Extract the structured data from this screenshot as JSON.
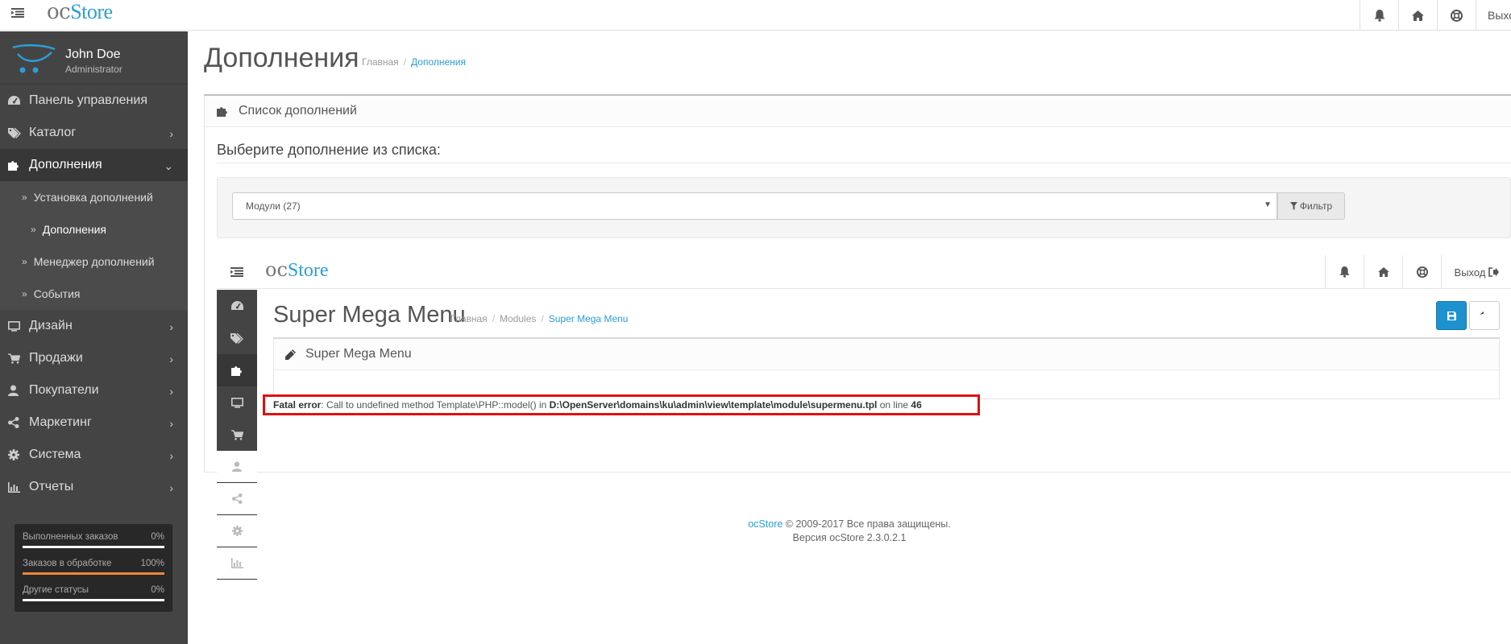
{
  "header": {
    "logo_oc": "oc",
    "logo_store": "Store",
    "logout_label": "Выход"
  },
  "profile": {
    "name": "John Doe",
    "role": "Administrator"
  },
  "sidebar": {
    "items": [
      {
        "label": "Панель управления",
        "icon": "dashboard-icon"
      },
      {
        "label": "Каталог",
        "icon": "tags-icon"
      },
      {
        "label": "Дополнения",
        "icon": "puzzle-icon"
      },
      {
        "label": "Дизайн",
        "icon": "monitor-icon"
      },
      {
        "label": "Продажи",
        "icon": "cart-icon"
      },
      {
        "label": "Покупатели",
        "icon": "user-icon"
      },
      {
        "label": "Маркетинг",
        "icon": "share-icon"
      },
      {
        "label": "Система",
        "icon": "gear-icon"
      },
      {
        "label": "Отчеты",
        "icon": "bar-chart-icon"
      }
    ],
    "subitems": [
      {
        "label": "Установка дополнений"
      },
      {
        "label": "Дополнения"
      },
      {
        "label": "Менеджер дополнений"
      },
      {
        "label": "События"
      }
    ]
  },
  "stats": [
    {
      "label": "Выполненных заказов",
      "value": "0%",
      "fraction": 0
    },
    {
      "label": "Заказов в обработке",
      "value": "100%",
      "fraction": 1
    },
    {
      "label": "Другие статусы",
      "value": "0%",
      "fraction": 0
    }
  ],
  "page": {
    "title": "Дополнения",
    "breadcrumb_home": "Главная",
    "breadcrumb_current": "Дополнения",
    "panel_title": "Список дополнений",
    "choose_label": "Выберите дополнение из списка:",
    "select_value": "Модули (27)",
    "filter_label": "Фильтр"
  },
  "frame": {
    "logo_oc": "oc",
    "logo_store": "Store",
    "logout_label": "Выход",
    "title": "Super Mega Menu",
    "breadcrumb_home": "Главная",
    "breadcrumb_mid": "Modules",
    "breadcrumb_current": "Super Mega Menu",
    "panel_title": "Super Mega Menu",
    "error_label": "Fatal error",
    "error_message": ": Call to undefined method Template\\PHP::model() in ",
    "error_path": "D:\\OpenServer\\domains\\ku\\admin\\view\\template\\module\\supermenu.tpl",
    "error_online": " on line ",
    "error_line": "46"
  },
  "footer": {
    "brand": "ocStore",
    "copyright": " © 2009-2017 Все права защищены.",
    "version": "Версия ocStore 2.3.0.2.1"
  },
  "colors": {
    "accent": "#2a9ed6",
    "sidebar": "#444444",
    "error_border": "#e01010",
    "progress": "#f0873a"
  }
}
